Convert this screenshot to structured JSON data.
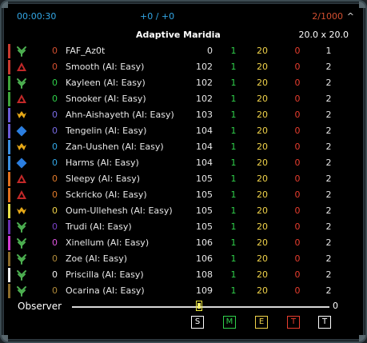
{
  "header": {
    "time": "00:00:30",
    "score": "+0 / +0",
    "units": "2/1000",
    "collapse": "^"
  },
  "map": {
    "name": "Adaptive Maridia",
    "size": "20.0 x 20.0"
  },
  "colors": {
    "faction": {
      "cybran": "#c22828",
      "uef": "#2b7ee0",
      "aeon": "#4caf50",
      "seraphim": "#e6a817"
    }
  },
  "players": [
    {
      "bar": "#c63a2f",
      "faction": "aeon",
      "team": "0",
      "team_color": "#d34f30",
      "name": "FAF_Az0t",
      "rating": "0",
      "mass": "1",
      "energy": "20",
      "score": "0",
      "tech": "1"
    },
    {
      "bar": "#c63a2f",
      "faction": "cybran",
      "team": "0",
      "team_color": "#d34f30",
      "name": "Smooth (AI: Easy)",
      "rating": "102",
      "mass": "1",
      "energy": "20",
      "score": "0",
      "tech": "2"
    },
    {
      "bar": "#3fa43a",
      "faction": "aeon",
      "team": "0",
      "team_color": "#2fd04a",
      "name": "Kayleen (AI: Easy)",
      "rating": "102",
      "mass": "1",
      "energy": "20",
      "score": "0",
      "tech": "2"
    },
    {
      "bar": "#3fa43a",
      "faction": "cybran",
      "team": "0",
      "team_color": "#2fd04a",
      "name": "Snooker (AI: Easy)",
      "rating": "102",
      "mass": "1",
      "energy": "20",
      "score": "0",
      "tech": "2"
    },
    {
      "bar": "#6b5bd6",
      "faction": "seraphim",
      "team": "0",
      "team_color": "#7a6ce6",
      "name": "Ahn-Aishayeth (AI: Easy)",
      "rating": "103",
      "mass": "1",
      "energy": "20",
      "score": "0",
      "tech": "2"
    },
    {
      "bar": "#6b5bd6",
      "faction": "uef",
      "team": "0",
      "team_color": "#7a6ce6",
      "name": "Tengelin (AI: Easy)",
      "rating": "104",
      "mass": "1",
      "energy": "20",
      "score": "0",
      "tech": "2"
    },
    {
      "bar": "#3b8fe0",
      "faction": "seraphim",
      "team": "0",
      "team_color": "#33a7e6",
      "name": "Zan-Uushen (AI: Easy)",
      "rating": "104",
      "mass": "1",
      "energy": "20",
      "score": "0",
      "tech": "2"
    },
    {
      "bar": "#3b8fe0",
      "faction": "uef",
      "team": "0",
      "team_color": "#33a7e6",
      "name": "Harms (AI: Easy)",
      "rating": "104",
      "mass": "1",
      "energy": "20",
      "score": "0",
      "tech": "2"
    },
    {
      "bar": "#e0701f",
      "faction": "cybran",
      "team": "0",
      "team_color": "#e07a2a",
      "name": "Sleepy (AI: Easy)",
      "rating": "105",
      "mass": "1",
      "energy": "20",
      "score": "0",
      "tech": "2"
    },
    {
      "bar": "#e0701f",
      "faction": "cybran",
      "team": "0",
      "team_color": "#e07a2a",
      "name": "Sckricko (AI: Easy)",
      "rating": "105",
      "mass": "1",
      "energy": "20",
      "score": "0",
      "tech": "2"
    },
    {
      "bar": "#e8e04a",
      "faction": "seraphim",
      "team": "0",
      "team_color": "#f1d34a",
      "name": "Oum-Ullehesh (AI: Easy)",
      "rating": "105",
      "mass": "1",
      "energy": "20",
      "score": "0",
      "tech": "2"
    },
    {
      "bar": "#6a2fb0",
      "faction": "aeon",
      "team": "0",
      "team_color": "#7a40c6",
      "name": "Trudi (AI: Easy)",
      "rating": "105",
      "mass": "1",
      "energy": "20",
      "score": "0",
      "tech": "2"
    },
    {
      "bar": "#d33dd3",
      "faction": "aeon",
      "team": "0",
      "team_color": "#e055e0",
      "name": "Xinellum (AI: Easy)",
      "rating": "106",
      "mass": "1",
      "energy": "20",
      "score": "0",
      "tech": "2"
    },
    {
      "bar": "#8a6a2a",
      "faction": "aeon",
      "team": "0",
      "team_color": "#b08a3a",
      "name": "Zoe (AI: Easy)",
      "rating": "106",
      "mass": "1",
      "energy": "20",
      "score": "0",
      "tech": "2"
    },
    {
      "bar": "#f0f0f0",
      "faction": "aeon",
      "team": "0",
      "team_color": "#f0f0f0",
      "name": "Priscilla (AI: Easy)",
      "rating": "108",
      "mass": "1",
      "energy": "20",
      "score": "0",
      "tech": "2"
    },
    {
      "bar": "#8a6a2a",
      "faction": "aeon",
      "team": "0",
      "team_color": "#b08a3a",
      "name": "Ocarina (AI: Easy)",
      "rating": "109",
      "mass": "1",
      "energy": "20",
      "score": "0",
      "tech": "2"
    }
  ],
  "observer": {
    "label": "Observer",
    "slider_value": "0",
    "slider_level": 0.5
  },
  "sort_buttons": [
    {
      "label": "S",
      "color": "#ffffff"
    },
    {
      "label": "M",
      "color": "#2fd04a"
    },
    {
      "label": "E",
      "color": "#f1d34a"
    },
    {
      "label": "T",
      "color": "#e83d2e"
    },
    {
      "label": "T",
      "color": "#ffffff"
    }
  ]
}
